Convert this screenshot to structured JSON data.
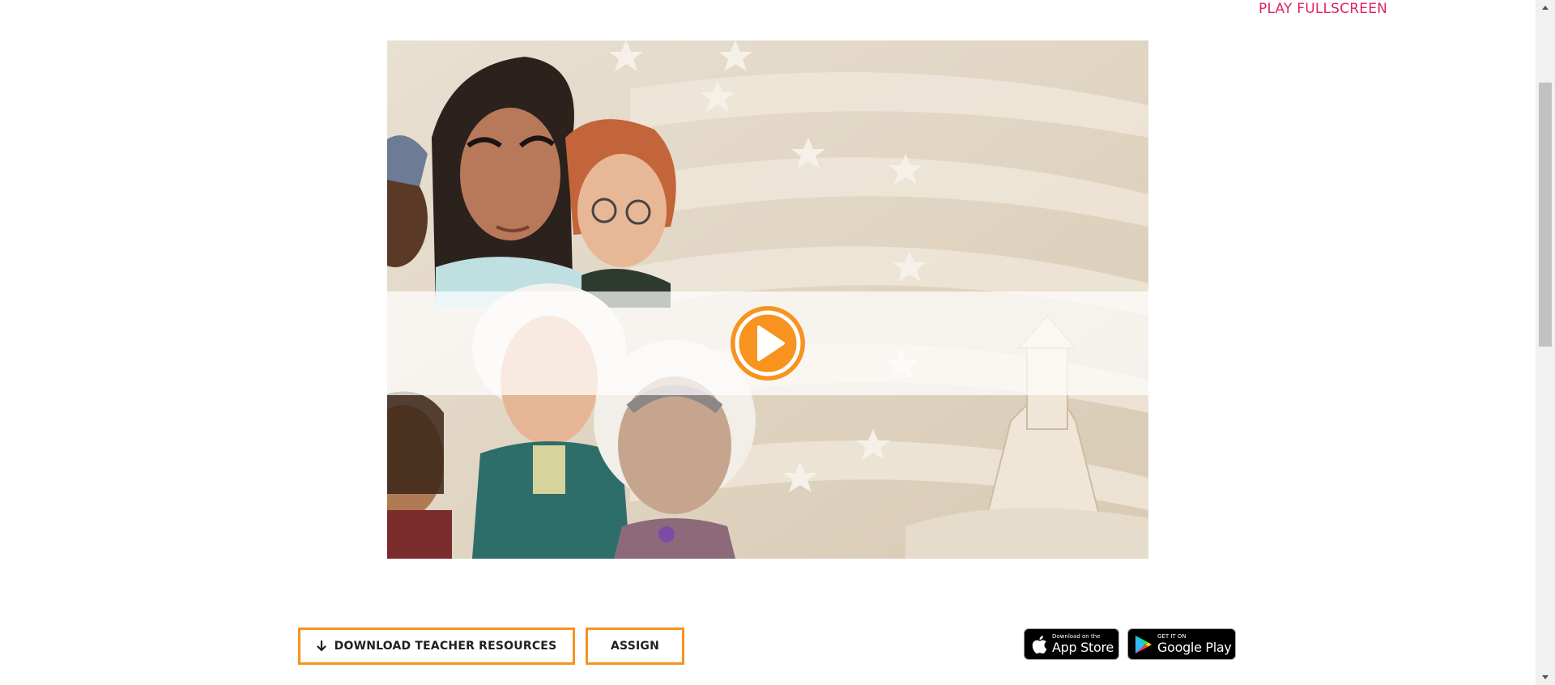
{
  "header": {
    "fullscreen_label": "PLAY FULLSCREEN"
  },
  "game": {
    "play_icon": "play-icon",
    "accent_color": "#f7931e"
  },
  "actions": {
    "download_label": "DOWNLOAD TEACHER RESOURCES",
    "download_icon": "download-arrow-icon",
    "assign_label": "ASSIGN"
  },
  "store_badges": {
    "app_store": {
      "small_text": "Download on the",
      "big_text": "App Store",
      "icon": "apple-icon"
    },
    "google_play": {
      "small_text": "GET IT ON",
      "big_text": "Google Play",
      "icon": "google-play-icon"
    }
  },
  "colors": {
    "link": "#e0245e",
    "button_border": "#f7931e",
    "badge_bg": "#000000"
  }
}
